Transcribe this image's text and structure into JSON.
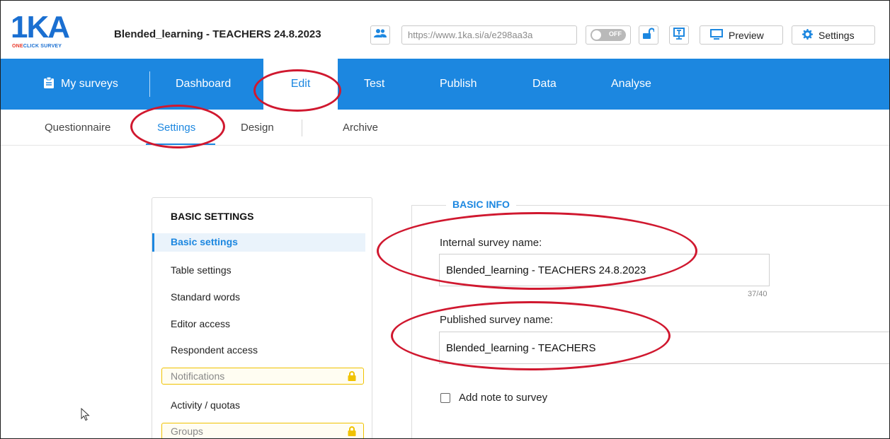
{
  "header": {
    "logo_mark": "1KA",
    "logo_sub_a": "ONE",
    "logo_sub_b": "CLICK SURVEY",
    "survey_title": "Blended_learning - TEACHERS 24.8.2023",
    "url": "https://www.1ka.si/a/e298aa3a",
    "toggle_label": "OFF",
    "preview_label": "Preview",
    "settings_label": "Settings"
  },
  "nav": {
    "items": [
      {
        "label": "My surveys"
      },
      {
        "label": "Dashboard"
      },
      {
        "label": "Edit"
      },
      {
        "label": "Test"
      },
      {
        "label": "Publish"
      },
      {
        "label": "Data"
      },
      {
        "label": "Analyse"
      }
    ],
    "active": "Edit"
  },
  "subnav": {
    "items": [
      {
        "label": "Questionnaire"
      },
      {
        "label": "Settings"
      },
      {
        "label": "Design"
      },
      {
        "label": "Archive"
      }
    ],
    "active": "Settings"
  },
  "sidebar": {
    "heading": "BASIC SETTINGS",
    "items": [
      {
        "label": "Basic settings"
      },
      {
        "label": "Table settings"
      },
      {
        "label": "Standard words"
      },
      {
        "label": "Editor access"
      },
      {
        "label": "Respondent access"
      },
      {
        "label": "Notifications"
      },
      {
        "label": "Activity / quotas"
      },
      {
        "label": "Groups"
      }
    ]
  },
  "basic_info": {
    "legend": "BASIC INFO",
    "internal_name_label": "Internal survey name:",
    "internal_name_value": "Blended_learning - TEACHERS 24.8.2023",
    "internal_name_counter": "37/40",
    "published_name_label": "Published survey name:",
    "published_name_value": "Blended_learning - TEACHERS",
    "note_label": "Add note to survey"
  },
  "colors": {
    "brand_blue": "#1c87e0",
    "annotation_red": "#d0182f",
    "lock_yellow": "#f0c200"
  }
}
